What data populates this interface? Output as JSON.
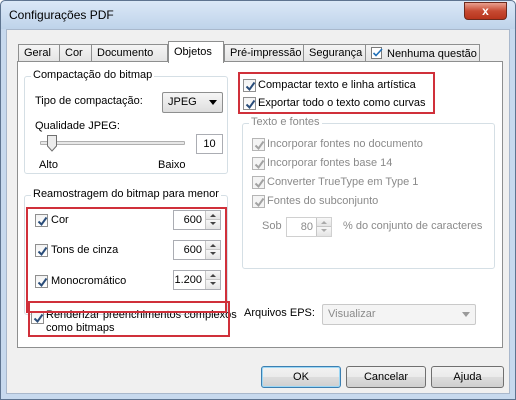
{
  "window": {
    "title": "Configurações PDF",
    "close_glyph": "x"
  },
  "tabs": [
    {
      "label": "Geral"
    },
    {
      "label": "Cor"
    },
    {
      "label": "Documento"
    },
    {
      "label": "Objetos",
      "active": true
    },
    {
      "label": "Pré-impressão"
    },
    {
      "label": "Segurança"
    },
    {
      "label": "Nenhuma questão",
      "icon": "checkmark-doc-icon"
    }
  ],
  "compaction": {
    "legend": "Compactação do bitmap",
    "type_label": "Tipo de compactação:",
    "type_value": "JPEG",
    "quality_label": "Qualidade JPEG:",
    "quality_value": "10",
    "quality_level": 0.05,
    "low_label": "Alto",
    "high_label": "Baixo"
  },
  "resample": {
    "legend": "Reamostragem do bitmap para menor",
    "items": [
      {
        "label": "Cor",
        "checked": true,
        "value": "600"
      },
      {
        "label": "Tons de cinza",
        "checked": true,
        "value": "600"
      },
      {
        "label": "Monocromático",
        "checked": true,
        "value": "1.200"
      }
    ]
  },
  "render_complex": {
    "label_line1": "Renderizar preenchimentos complexos",
    "label_line2": "como bitmaps",
    "checked": true
  },
  "top_options": [
    {
      "label": "Compactar texto e linha artística",
      "checked": true
    },
    {
      "label": "Exportar todo o texto como curvas",
      "checked": true
    }
  ],
  "text_fonts": {
    "legend": "Texto e fontes",
    "items": [
      {
        "label": "Incorporar fontes no documento",
        "checked": true
      },
      {
        "label": "Incorporar fontes base 14",
        "checked": true
      },
      {
        "label": "Converter TrueType em Type 1",
        "checked": true
      },
      {
        "label": "Fontes do subconjunto",
        "checked": true
      }
    ],
    "subset_prefix": "Sob",
    "subset_value": "80",
    "subset_suffix": "% do conjunto de caracteres"
  },
  "eps": {
    "label": "Arquivos EPS:",
    "value": "Visualizar"
  },
  "buttons": {
    "ok": "OK",
    "cancel": "Cancelar",
    "help": "Ajuda"
  },
  "colors": {
    "highlight": "#d0303a",
    "accent_border": "#3c7fb1",
    "disabled_text": "#8a8a8a"
  }
}
